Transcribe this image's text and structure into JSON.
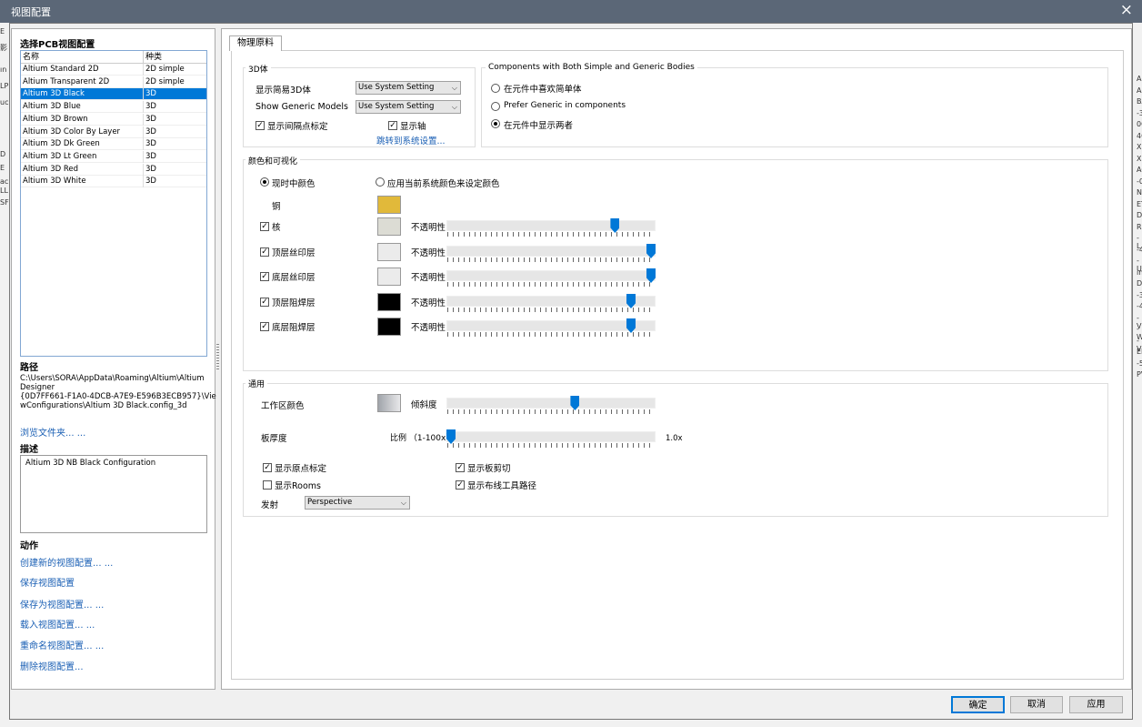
{
  "window": {
    "title": "视图配置",
    "close": "×"
  },
  "background": {
    "left_chars": [
      "E",
      "影",
      "ın",
      "LP",
      "uc",
      "D",
      "E",
      "ac",
      "LL",
      "SF"
    ],
    "right_chars": [
      "A",
      "AA",
      "BA",
      "-3",
      "0C",
      "4C",
      "X3",
      "X3",
      "AC",
      "-0",
      "N",
      "ET",
      "DV",
      "RI",
      "-L",
      "-4",
      "-U",
      "in",
      "D",
      "-3",
      "-4",
      "-V",
      "-W",
      "-V",
      "EM",
      "-5",
      "PV"
    ]
  },
  "left": {
    "select_header": "选择PCB视图配置",
    "columns": [
      "名称",
      "种类"
    ],
    "rows": [
      {
        "name": "Altium Standard 2D",
        "type": "2D simple"
      },
      {
        "name": "Altium Transparent 2D",
        "type": "2D simple"
      },
      {
        "name": "Altium 3D Black",
        "type": "3D",
        "selected": true
      },
      {
        "name": "Altium 3D Blue",
        "type": "3D"
      },
      {
        "name": "Altium 3D Brown",
        "type": "3D"
      },
      {
        "name": "Altium 3D Color By Layer",
        "type": "3D"
      },
      {
        "name": "Altium 3D Dk Green",
        "type": "3D"
      },
      {
        "name": "Altium 3D Lt Green",
        "type": "3D"
      },
      {
        "name": "Altium 3D Red",
        "type": "3D"
      },
      {
        "name": "Altium 3D White",
        "type": "3D"
      }
    ],
    "path_header": "路径",
    "path_lines": [
      "C:\\Users\\SORA\\AppData\\Roaming\\Altium\\Altium",
      "Designer",
      "{0D7FF661-F1A0-4DCB-A7E9-E596B3ECB957}\\Vie",
      "wConfigurations\\Altium 3D Black.config_3d"
    ],
    "browse_link": "浏览文件夹... ...",
    "desc_header": "描述",
    "description": "Altium 3D NB Black Configuration",
    "actions_header": "动作",
    "actions": [
      "创建新的视图配置... ...",
      "保存视图配置",
      "保存为视图配置... ...",
      "载入视图配置... ...",
      "重命名视图配置... ...",
      "删除视图配置..."
    ]
  },
  "tab": {
    "label": "物理原料"
  },
  "body3d": {
    "title": "3D体",
    "simple_label": "显示简易3D体",
    "simple_value": "Use System Setting",
    "generic_label": "Show Generic Models",
    "generic_value": "Use System Setting",
    "interval_label": "显示间隔点标定",
    "axis_label": "显示轴",
    "sys_link": "跳转到系统设置..."
  },
  "components": {
    "title": "Components with Both Simple and Generic Bodies",
    "opt1": "在元件中喜欢简单体",
    "opt2": "Prefer Generic in components",
    "opt3": "在元件中显示两者"
  },
  "color": {
    "title": "颜色和可视化",
    "radio1": "现时中颜色",
    "radio2": "应用当前系统颜色来设定颜色",
    "copper_label": "铜",
    "copper_color": "#e1b93a",
    "opacity_label": "不透明性",
    "layers": [
      {
        "name": "核",
        "color": "#dcdcd4",
        "opacity": 0.82
      },
      {
        "name": "顶层丝印层",
        "color": "#ebebeb",
        "opacity": 1.0
      },
      {
        "name": "底层丝印层",
        "color": "#ebebeb",
        "opacity": 1.0
      },
      {
        "name": "顶层阻焊层",
        "color": "#000000",
        "opacity": 0.9
      },
      {
        "name": "底层阻焊层",
        "color": "#000000",
        "opacity": 0.9
      }
    ]
  },
  "general": {
    "title": "通用",
    "workspace_label": "工作区颜色",
    "gradient_label": "倾斜度",
    "gradient_value": 0.62,
    "thickness_label": "板厚度",
    "ratio_label": "比例 （1-100x）",
    "ratio_value": "1.0x",
    "ratio_pos": 0.0,
    "chk_origin": "显示原点标定",
    "chk_rooms": "显示Rooms",
    "chk_cut": "显示板剪切",
    "chk_route": "显示布线工具路径",
    "proj_label": "发射",
    "proj_value": "Perspective"
  },
  "buttons": {
    "ok": "确定",
    "cancel": "取消",
    "apply": "应用"
  },
  "colors": {
    "accent": "#0078d7",
    "titlebar": "#5b6777",
    "link": "#1a5fb4"
  }
}
